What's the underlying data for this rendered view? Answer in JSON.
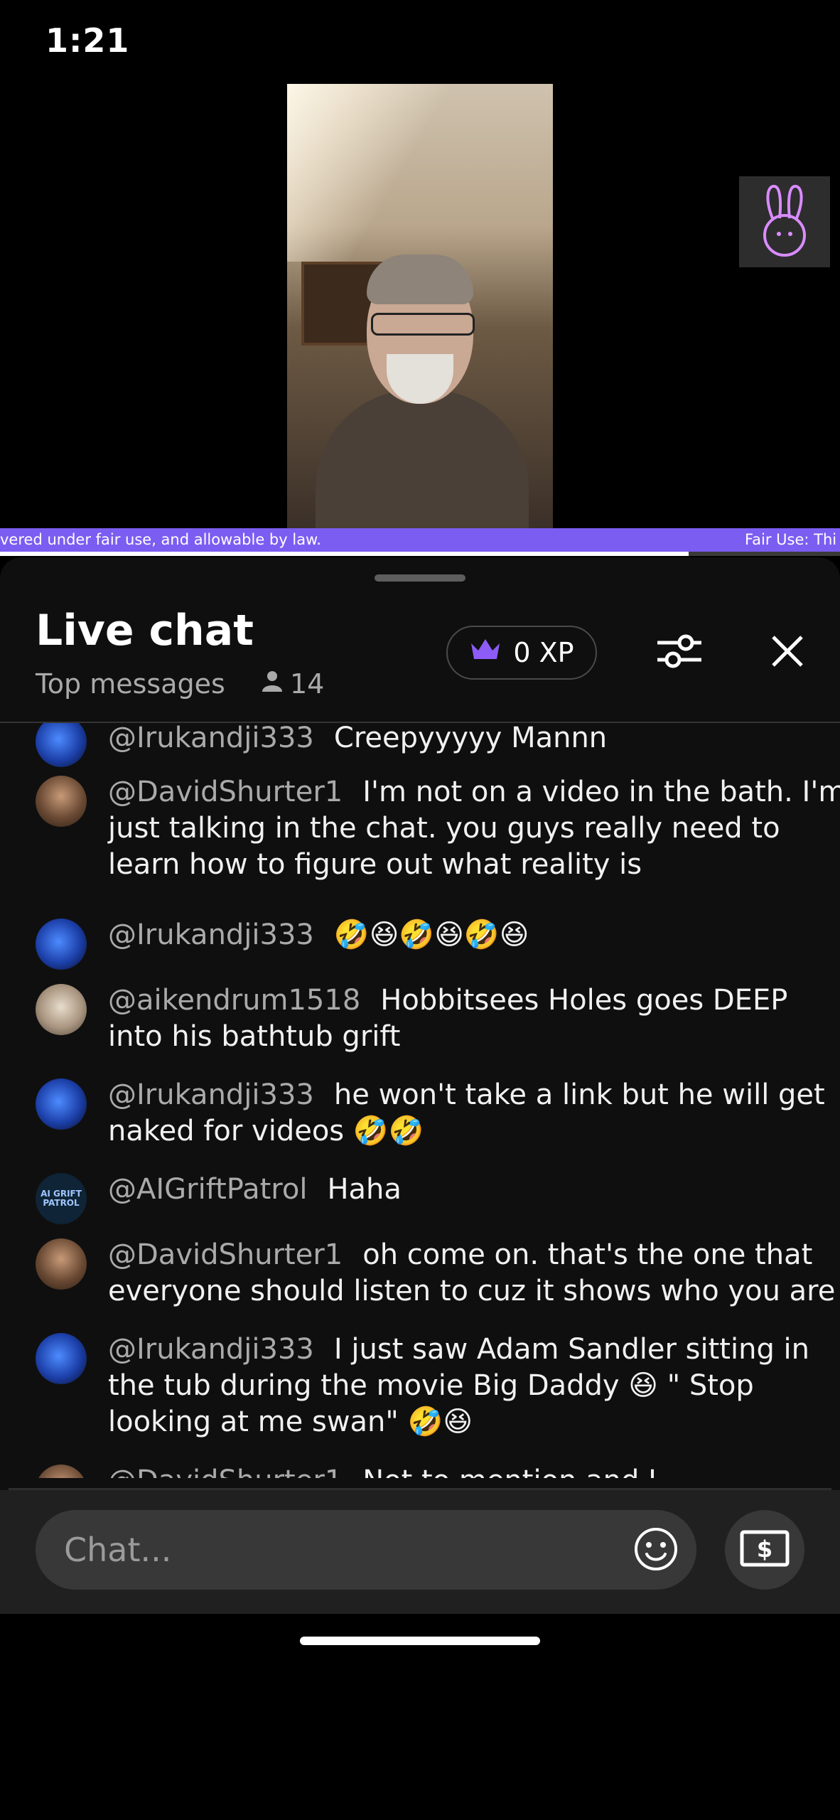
{
  "status_bar": {
    "time": "1:21"
  },
  "video": {
    "ticker_left": "vered under fair use, and allowable by law.",
    "ticker_right": "Fair Use: Thi",
    "progress": 0.82
  },
  "chat_header": {
    "title": "Live chat",
    "mode": "Top messages",
    "viewer_count": "14",
    "xp_label": "0 XP",
    "xp_icon": "crown-icon",
    "filter_icon": "sliders-icon",
    "close_icon": "close-icon"
  },
  "messages": [
    {
      "author": "@Irukandji333",
      "text": "Creepyyyyy Mannn",
      "avatar": "jellyfish"
    },
    {
      "author": "@DavidShurter1",
      "text": "I'm not on a video in the bath. I'm just talking in the chat. you guys really need to learn how to figure out what reality is",
      "avatar": "david"
    },
    {
      "author": "@Irukandji333",
      "text": "🤣😆🤣😆🤣😆",
      "avatar": "jellyfish"
    },
    {
      "author": "@aikendrum1518",
      "text": "Hobbitsees Holes goes DEEP into his bathtub grift",
      "avatar": "aiken"
    },
    {
      "author": "@Irukandji333",
      "text": "he won't take a link but he will get naked for videos 🤣🤣",
      "avatar": "jellyfish"
    },
    {
      "author": "@AIGriftPatrol",
      "text": "Haha",
      "avatar": "ai-grift-patrol",
      "avatar_text": "AI GRIFT PATROL"
    },
    {
      "author": "@DavidShurter1",
      "text": "oh come on. that's the one that everyone should listen to cuz it shows who you are",
      "avatar": "david"
    },
    {
      "author": "@Irukandji333",
      "text": "I just saw Adam Sandler sitting in the tub during the movie Big Daddy 😆 \" Stop looking at me swan\" 🤣😆",
      "avatar": "jellyfish"
    },
    {
      "author": "@DavidShurter1",
      "text": "Not to mention and I quoting Social Security here committee and myriad amount of attempts at identity theft on my disability",
      "avatar": "david"
    }
  ],
  "composer": {
    "placeholder": "Chat...",
    "emoji_icon": "smiley-icon",
    "money_icon": "dollar-bill-icon"
  },
  "colors": {
    "panel_bg": "#0f0f0f",
    "ticker": "#7b5df2",
    "author": "#aaaaaa",
    "crown": "#8d5cf6",
    "heart": "#e8232f"
  }
}
